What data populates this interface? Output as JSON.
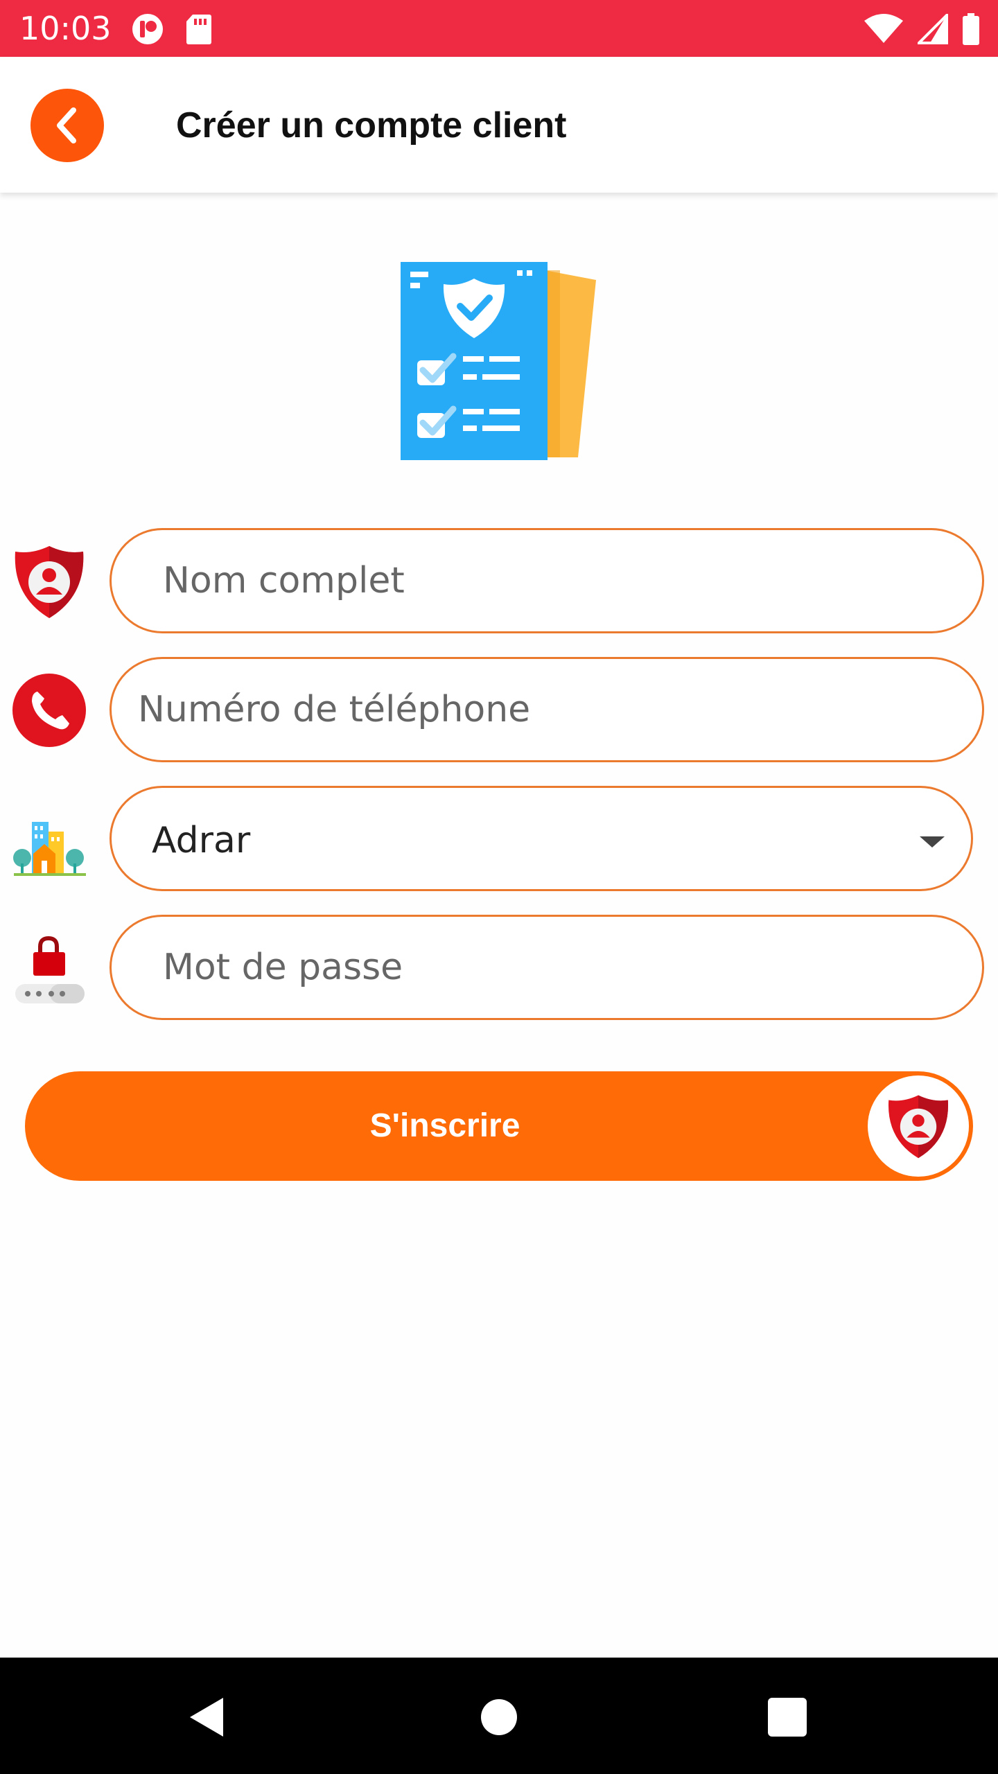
{
  "status_bar": {
    "time": "10:03",
    "icons_left": [
      "app-notification-icon",
      "sd-card-icon"
    ],
    "icons_right": [
      "wifi-icon",
      "cell-signal-icon",
      "battery-icon"
    ],
    "background": "#ee2b43"
  },
  "header": {
    "back_icon": "chevron-left-icon",
    "title": "Créer un compte client",
    "accent": "#fd5509"
  },
  "hero": {
    "icon": "checklist-document-icon"
  },
  "form": {
    "full_name": {
      "icon": "user-shield-icon",
      "placeholder": "Nom complet",
      "value": ""
    },
    "phone": {
      "icon": "phone-icon",
      "placeholder": "Numéro de téléphone",
      "value": ""
    },
    "wilaya": {
      "icon": "city-buildings-icon",
      "selected": "Adrar",
      "arrow_icon": "dropdown-arrow-icon"
    },
    "password": {
      "icon": "lock-password-icon",
      "placeholder": "Mot de passe",
      "value": ""
    },
    "border_color": "#ec7a2e"
  },
  "submit": {
    "label": "S'inscrire",
    "badge_icon": "user-shield-icon",
    "color": "#fe6b07"
  },
  "nav_bar": {
    "icons": [
      "back-triangle-icon",
      "home-circle-icon",
      "recents-square-icon"
    ]
  }
}
